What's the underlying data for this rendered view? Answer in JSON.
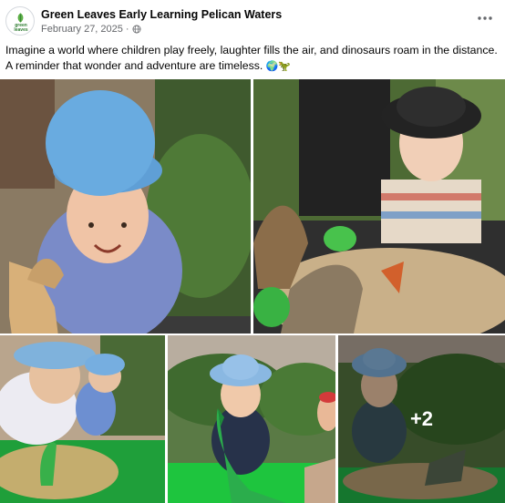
{
  "post": {
    "page_name": "Green Leaves Early Learning Pelican Waters",
    "date": "February 27, 2025",
    "separator": "·",
    "privacy_icon": "globe-icon",
    "more_icon": "more-options-icon",
    "avatar_text": "green leaves",
    "caption": "Imagine a world where children play freely, laughter fills the air, and dinosaurs roam in the distance. A reminder that wonder and adventure are timeless.",
    "caption_emojis": "🌍🦖"
  },
  "gallery": {
    "photo_count_visible": 5,
    "more_photos_label": "+2",
    "photos": [
      {
        "name": "photo-child-blue-hat-dinosaur"
      },
      {
        "name": "photo-child-black-hat-sandpit"
      },
      {
        "name": "photo-child-green-water-tub"
      },
      {
        "name": "photo-child-holding-green-dinosaur"
      },
      {
        "name": "photo-child-sandpit-dinosaurs"
      }
    ]
  },
  "colors": {
    "text_primary": "#050505",
    "text_secondary": "#65676b",
    "brand_green": "#2f7d32",
    "overlay": "rgba(0,0,0,0.35)"
  }
}
